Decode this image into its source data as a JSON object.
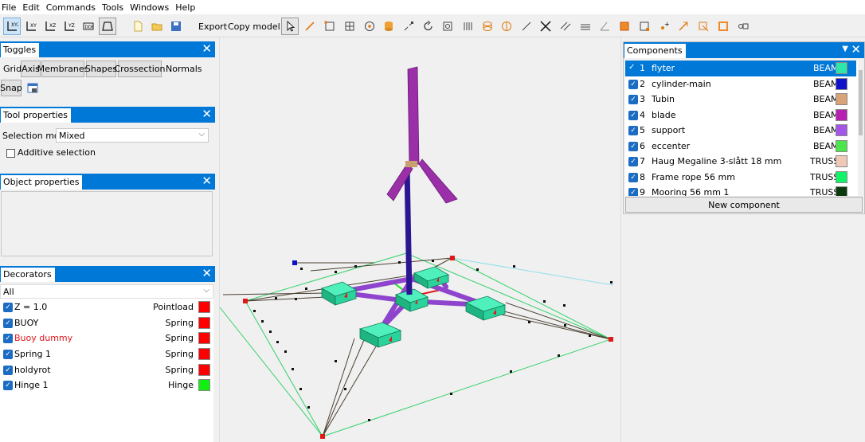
{
  "menu": [
    "File",
    "Edit",
    "Commands",
    "Tools",
    "Windows",
    "Help"
  ],
  "toolbar": {
    "export_label": "Export",
    "copy_model_label": "Copy model",
    "icons": [
      "view-xyz-icon",
      "view-xy-icon",
      "view-xz-icon",
      "view-yz-icon",
      "view-3d-box-icon",
      "perspective-icon",
      "new-file-icon",
      "open-folder-icon",
      "save-icon",
      "select-pointer-icon",
      "draw-line-icon",
      "rectangle-icon",
      "grid-rect-icon",
      "circle-node-icon",
      "cylinder-stack-icon",
      "scale-icon",
      "rotate-icon",
      "mesh-icon",
      "bars-icon",
      "cylinder-icon",
      "half-circle-icon",
      "line-icon",
      "cross-icon",
      "parallel-icon",
      "hatch-icon",
      "angle-icon",
      "orange-square-icon",
      "node-square-icon",
      "add-node-icon",
      "arrow-node-icon",
      "arrow-square-icon",
      "orange-box-icon",
      "link-icon"
    ]
  },
  "toggles": {
    "title": "Toggles",
    "buttons": [
      "Grid",
      "Axis",
      "Membranes",
      "Shapes",
      "Crossection",
      "Normals",
      "Snap"
    ]
  },
  "tool_properties": {
    "title": "Tool properties",
    "selection_model_label": "Selection model",
    "selection_model_value": "Mixed",
    "additive_selection_label": "Additive selection"
  },
  "object_properties": {
    "title": "Object properties"
  },
  "decorators": {
    "title": "Decorators",
    "filter": "All",
    "items": [
      {
        "name": "Z = 1.0",
        "type": "Pointload",
        "color": "#ff0000",
        "name_color": "#000000"
      },
      {
        "name": "BUOY",
        "type": "Spring",
        "color": "#ff0000",
        "name_color": "#000000"
      },
      {
        "name": "Buoy dummy",
        "type": "Spring",
        "color": "#ff0000",
        "name_color": "#e0161a"
      },
      {
        "name": "Spring 1",
        "type": "Spring",
        "color": "#ff0000",
        "name_color": "#000000"
      },
      {
        "name": "holdyrot",
        "type": "Spring",
        "color": "#ff0000",
        "name_color": "#000000"
      },
      {
        "name": "Hinge 1",
        "type": "Hinge",
        "color": "#11ee11",
        "name_color": "#000000"
      }
    ]
  },
  "components": {
    "title": "Components",
    "new_button": "New component",
    "items": [
      {
        "num": "1",
        "name": "flyter",
        "type": "BEAM",
        "color": "#2ee6a8",
        "selected": true
      },
      {
        "num": "2",
        "name": "cylinder-main",
        "type": "BEAM",
        "color": "#1010c8",
        "selected": false
      },
      {
        "num": "3",
        "name": "Tubin",
        "type": "BEAM",
        "color": "#d9a37a",
        "selected": false
      },
      {
        "num": "4",
        "name": "blade",
        "type": "BEAM",
        "color": "#b61fb2",
        "selected": false
      },
      {
        "num": "5",
        "name": "support",
        "type": "BEAM",
        "color": "#a257e8",
        "selected": false
      },
      {
        "num": "6",
        "name": "eccenter",
        "type": "BEAM",
        "color": "#4be64b",
        "selected": false
      },
      {
        "num": "7",
        "name": "Haug Megaline 3-slått 18 mm",
        "type": "TRUSS",
        "color": "#efc8b8",
        "selected": false
      },
      {
        "num": "8",
        "name": "Frame rope 56 mm",
        "type": "TRUSS",
        "color": "#14f26a",
        "selected": false
      },
      {
        "num": "9",
        "name": "Mooring 56 mm 1",
        "type": "TRUSS",
        "color": "#0c3a0c",
        "selected": false
      }
    ]
  }
}
